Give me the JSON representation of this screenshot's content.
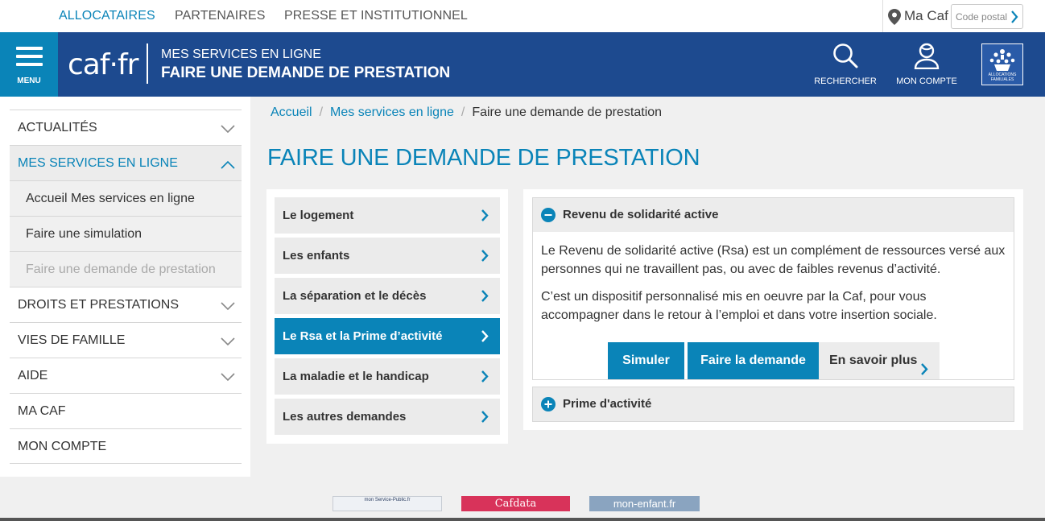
{
  "top_nav": {
    "links": [
      "ALLOCATAIRES",
      "PARTENAIRES",
      "PRESSE ET INSTITUTIONNEL"
    ],
    "ma_caf_label": "Ma Caf",
    "code_postal_placeholder": "Code postal"
  },
  "header": {
    "menu_label": "MENU",
    "logo_text": "caf·fr",
    "subtitle": "MES SERVICES EN LIGNE",
    "title": "FAIRE UNE DEMANDE DE PRESTATION",
    "search_label": "RECHERCHER",
    "account_label": "MON COMPTE",
    "brand_logo_text": "ALLOCATIONS FAMILIALES"
  },
  "sidebar": {
    "items": [
      {
        "label": "ACTUALITÉS"
      },
      {
        "label": "MES SERVICES EN LIGNE"
      },
      {
        "label": "Accueil Mes services en ligne"
      },
      {
        "label": "Faire une simulation"
      },
      {
        "label": "Faire une demande de prestation"
      },
      {
        "label": "DROITS ET PRESTATIONS"
      },
      {
        "label": "VIES DE FAMILLE"
      },
      {
        "label": "AIDE"
      },
      {
        "label": "MA CAF"
      },
      {
        "label": "MON COMPTE"
      }
    ]
  },
  "breadcrumb": {
    "items": [
      "Accueil",
      "Mes services en ligne",
      "Faire une demande de prestation"
    ],
    "separator": "/"
  },
  "page_title": "FAIRE UNE DEMANDE DE PRESTATION",
  "categories": [
    {
      "label": "Le logement"
    },
    {
      "label": "Les enfants"
    },
    {
      "label": "La séparation et le décès"
    },
    {
      "label": "Le Rsa et la Prime d’activité"
    },
    {
      "label": "La maladie et le handicap"
    },
    {
      "label": "Les autres demandes"
    }
  ],
  "accordion": {
    "rsa": {
      "title": "Revenu de solidarité active",
      "para1": "Le Revenu de solidarité active (Rsa) est un complément de ressources versé aux personnes qui ne travaillent pas, ou avec de faibles revenus d’activité.",
      "para2": "C’est un dispositif personnalisé mis en oeuvre par la Caf, pour vous accompagner dans le retour à l’emploi et dans votre insertion sociale.",
      "btn_simuler": "Simuler",
      "btn_demande": "Faire la demande",
      "btn_savoir": "En savoir plus"
    },
    "prime": {
      "title": "Prime d'activité"
    }
  },
  "footer": {
    "logo1": "mon Service-Public.fr",
    "logo2": "Cafdata",
    "logo3": "mon-enfant.fr"
  },
  "colors": {
    "accent": "#0a84b8",
    "header_bg": "#1d4a8f"
  }
}
